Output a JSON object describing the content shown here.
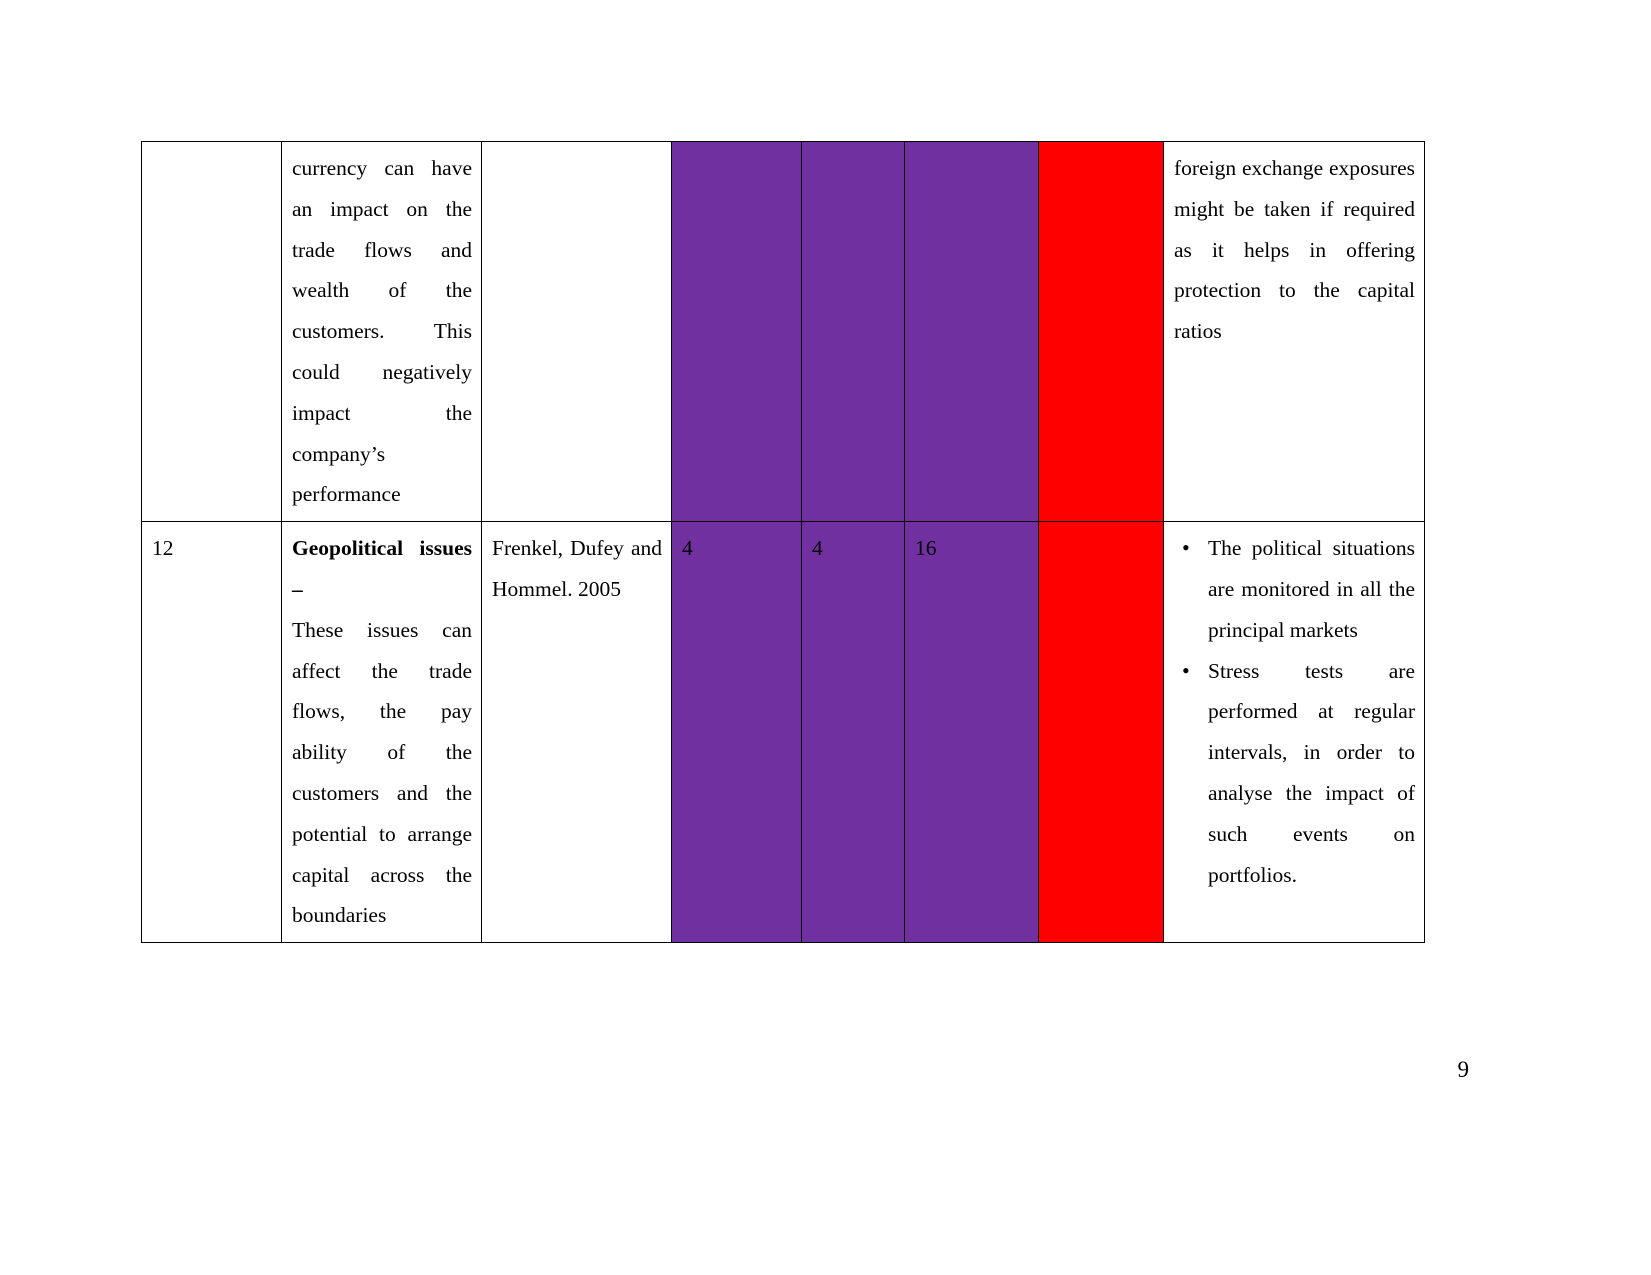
{
  "document": {
    "page_number": "9",
    "colors": {
      "purple_cell": "#7030A0",
      "red_cell": "#FF0000",
      "border": "#000000",
      "text": "#000000"
    }
  },
  "table": {
    "rows": [
      {
        "id": "row-continued",
        "no": "",
        "description": "currency can have an impact on the trade flows and wealth of the customers. This could negatively impact the company’s performance",
        "description_bold_prefix": "",
        "reference": "",
        "probability": "",
        "impact": "",
        "score": "",
        "rating": "",
        "mitigation_paragraph": "foreign exchange exposures might be taken if required as it helps in offering protection to the capital ratios",
        "mitigation_bullets": []
      },
      {
        "id": "row-12",
        "no": "12",
        "description_bold_prefix": "Geopolitical issues –",
        "description": "These issues can affect the trade flows, the pay ability of the customers and the potential to arrange capital across the boundaries",
        "reference": "Frenkel, Dufey and Hommel. 2005",
        "probability": "4",
        "impact": "4",
        "score": "16",
        "rating": "",
        "mitigation_paragraph": "",
        "mitigation_bullets": [
          "The political situations are monitored in all the principal markets",
          "Stress tests are performed at regular intervals, in order to analyse the impact of such events on portfolios."
        ]
      }
    ]
  }
}
